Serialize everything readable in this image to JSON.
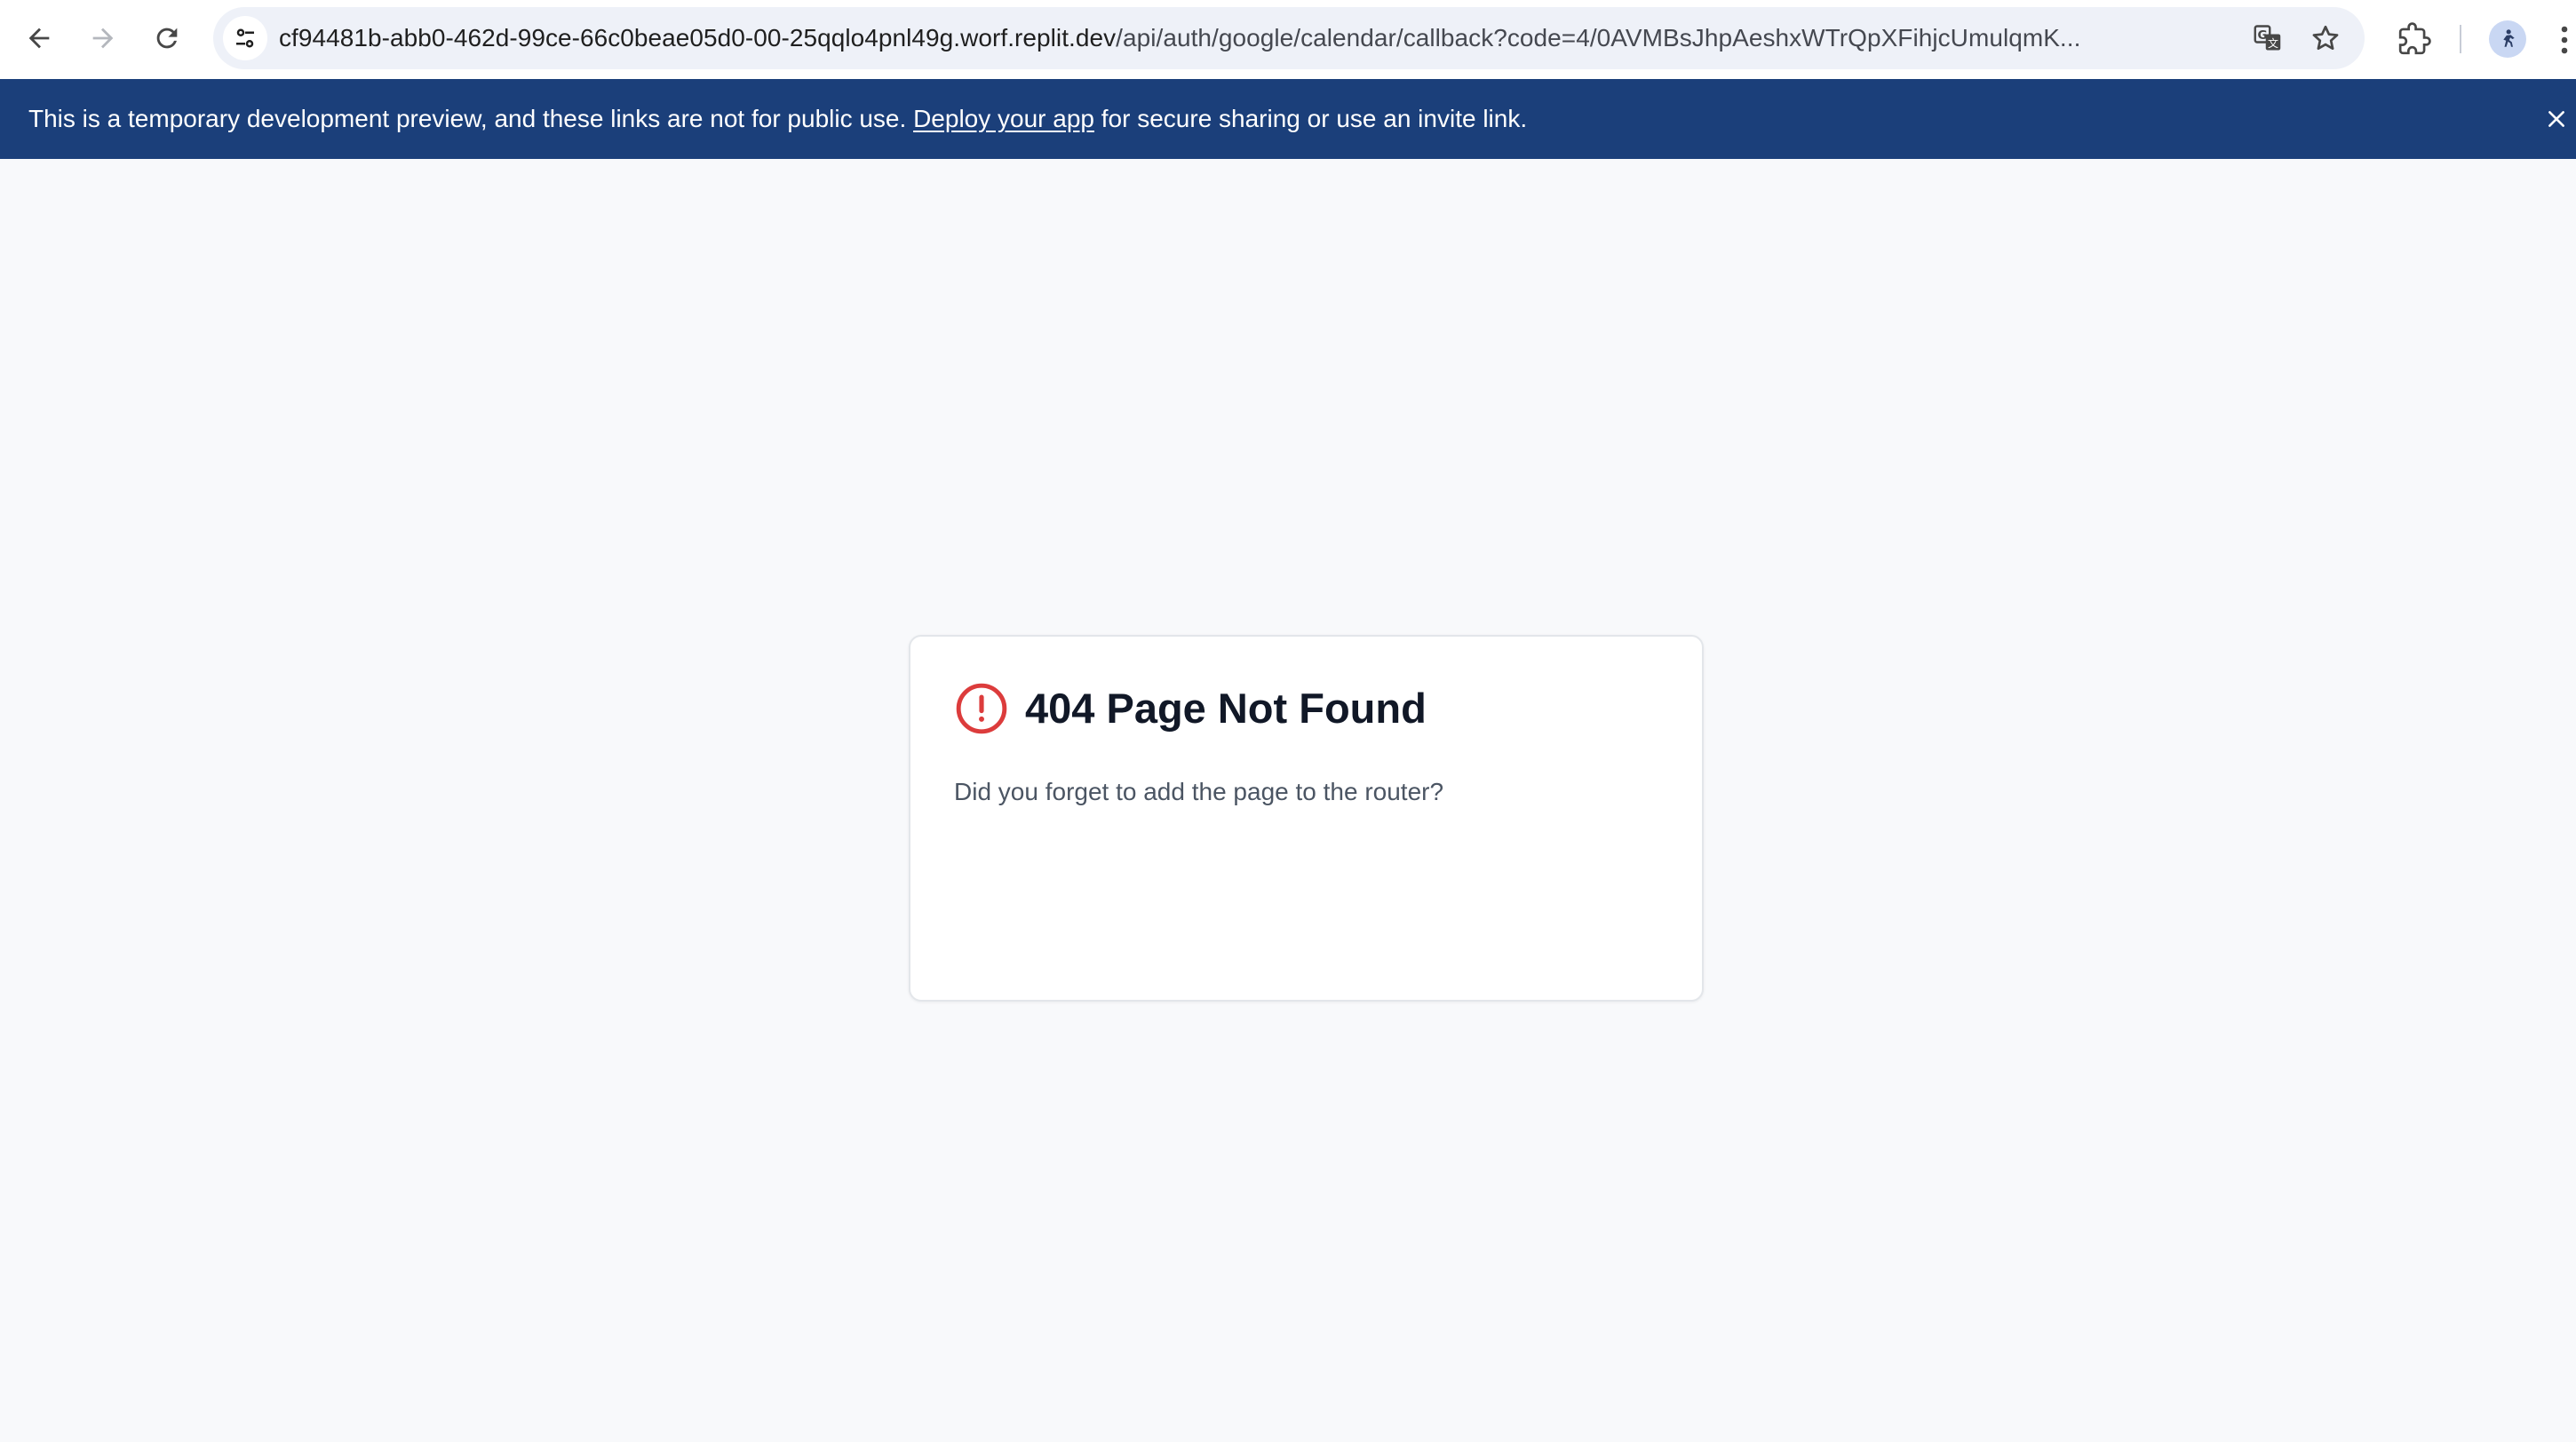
{
  "browser": {
    "url_host": "cf94481b-abb0-462d-99ce-66c0beae05d0-00-25qqlo4pnl49g.worf.replit.dev",
    "url_path": "/api/auth/google/calendar/callback?code=4/0AVMBsJhpAeshxWTrQpXFihjcUmulqmK...",
    "icons": {
      "back": "back-arrow-icon",
      "forward": "forward-arrow-icon",
      "reload": "reload-icon",
      "site_info": "site-info-tune-icon",
      "translate": "translate-icon",
      "bookmark": "star-icon",
      "extensions": "puzzle-piece-icon",
      "profile": "profile-avatar-icon",
      "menu": "kebab-menu-icon"
    }
  },
  "banner": {
    "text_before": "This is a temporary development preview, and these links are not for public use.",
    "link_label": "Deploy your app",
    "text_after": "for secure sharing or use an invite link.",
    "background_color": "#1b3f7a",
    "close_icon": "close-icon"
  },
  "not_found": {
    "title": "404 Page Not Found",
    "description": "Did you forget to add the page to the router?",
    "icon": "alert-circle-icon",
    "icon_color": "#dc3c3c"
  }
}
